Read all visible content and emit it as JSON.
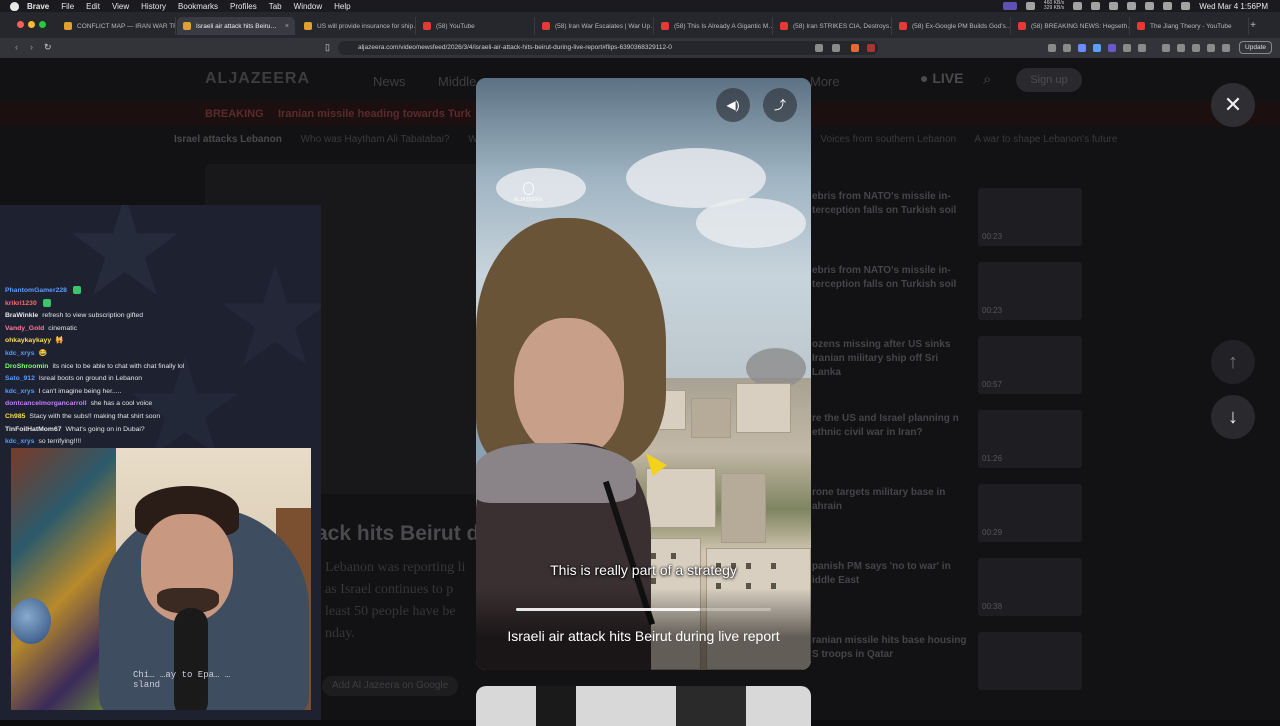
{
  "menubar": {
    "app": "Brave",
    "items": [
      "File",
      "Edit",
      "View",
      "History",
      "Bookmarks",
      "Profiles",
      "Tab",
      "Window",
      "Help"
    ],
    "network": [
      "460 KB/s",
      "329 KB/s"
    ],
    "clock": "Wed Mar 4  1:56PM"
  },
  "tabs": [
    {
      "title": "CONFLICT MAP — IRAN WAR TR…",
      "color": "#e0a030"
    },
    {
      "title": "Israeli air attack hits Beiru…",
      "color": "#e0a030",
      "active": true
    },
    {
      "title": "US will provide insurance for ship…",
      "color": "#e0a030"
    },
    {
      "title": "(58) YouTube",
      "color": "#e53935"
    },
    {
      "title": "(58) Iran War Escalates | War Up…",
      "color": "#e53935"
    },
    {
      "title": "(58) This Is Already A Gigantic M…",
      "color": "#e53935"
    },
    {
      "title": "(58) Iran STRIKES CIA, Destroys…",
      "color": "#e53935"
    },
    {
      "title": "(58) Ex-Google PM Builds God's…",
      "color": "#e53935"
    },
    {
      "title": "(58) BREAKING NEWS: Hegseth…",
      "color": "#e53935"
    },
    {
      "title": "The Jiang Theory - YouTube",
      "color": "#e53935"
    }
  ],
  "address": {
    "url": "aljazeera.com/video/newsfeed/2026/3/4/israeli-air-attack-hits-beirut-during-live-report#flips-6390368329112-0",
    "update_label": "Update"
  },
  "site": {
    "logo": "ALJAZEERA",
    "nav": [
      "News",
      "Middle"
    ],
    "nav_more": "More",
    "live": "LIVE",
    "signup": "Sign up",
    "breaking_label": "BREAKING",
    "breaking_text": "Iranian missile heading towards Turk",
    "subnav": [
      "Israel attacks Lebanon",
      "Who was Haytham Ali Tabatabai?",
      "W",
      "Voices from southern Lebanon",
      "A war to shape Lebanon's future"
    ],
    "article_title": "ack hits Beirut du",
    "article_lines": [
      "Lebanon was reporting li",
      "as Israel continues to p",
      "least 50 people have be",
      "nday."
    ],
    "google_button": "Add Al Jazeera on Google",
    "related": [
      {
        "title": "ebris from NATO's missile in-terception falls on Turkish soil",
        "duration": "00:23"
      },
      {
        "title": "ebris from NATO's missile in-terception falls on Turkish soil",
        "duration": "00:23"
      },
      {
        "title": "ozens missing after US sinks Iranian military ship off Sri Lanka",
        "duration": "00:57"
      },
      {
        "title": "re the US and Israel planning n ethnic civil war in Iran?",
        "duration": "01:26"
      },
      {
        "title": "rone targets military base in ahrain",
        "duration": "00:29"
      },
      {
        "title": "panish PM says 'no to war' in iddle East",
        "duration": "00:38"
      },
      {
        "title": "ranian missile hits base housing S troops in Qatar",
        "duration": ""
      }
    ]
  },
  "chat": [
    {
      "user": "PhantomGamer228",
      "color": "#5b9bff",
      "msg": "",
      "badge": true
    },
    {
      "user": "krikri1230",
      "color": "#ff6a6a",
      "msg": "",
      "badge": true
    },
    {
      "user": "BraWinkle",
      "color": "#e8e8e8",
      "msg": "refresh to view subscription gifted"
    },
    {
      "user": "Vandy_Gold",
      "color": "#ff7aa0",
      "msg": "cinematic"
    },
    {
      "user": "ohkaykaykayy",
      "color": "#ffdd55",
      "msg": "🙀"
    },
    {
      "user": "kdc_xrys",
      "color": "#5b9bff",
      "msg": "😂"
    },
    {
      "user": "DroShroomin",
      "color": "#7dff6a",
      "msg": "its nice to be able to chat with chat finally lol"
    },
    {
      "user": "Sato_912",
      "color": "#5b9bff",
      "msg": "Isreal boots on ground in Lebanon"
    },
    {
      "user": "kdc_xrys",
      "color": "#5b9bff",
      "msg": "I can't imagine being her....."
    },
    {
      "user": "dontcancelmorgancarroll",
      "color": "#c77dff",
      "msg": "she has a cool voice"
    },
    {
      "user": "Ch985",
      "color": "#ffdd55",
      "msg": "Stacy with the subs!! making that shirt soon"
    },
    {
      "user": "TinFoilHatMom67",
      "color": "#e8e8e8",
      "msg": "What's going on in Dubai?"
    },
    {
      "user": "kdc_xrys",
      "color": "#5b9bff",
      "msg": "so terrifying!!!!"
    }
  ],
  "webcam_shirt": "Chi…  …ay to  Epa… …sland",
  "video": {
    "caption": "This is really part of a strategy",
    "title": "Israeli air attack hits Beirut during live report",
    "watermark": "ALJAZEERA",
    "mute_icon": "speaker-icon",
    "share_icon": "share-icon",
    "progress_fraction": 0.72
  },
  "controls": {
    "close_icon": "close-icon",
    "up_icon": "arrow-up-icon",
    "down_icon": "arrow-down-icon"
  }
}
